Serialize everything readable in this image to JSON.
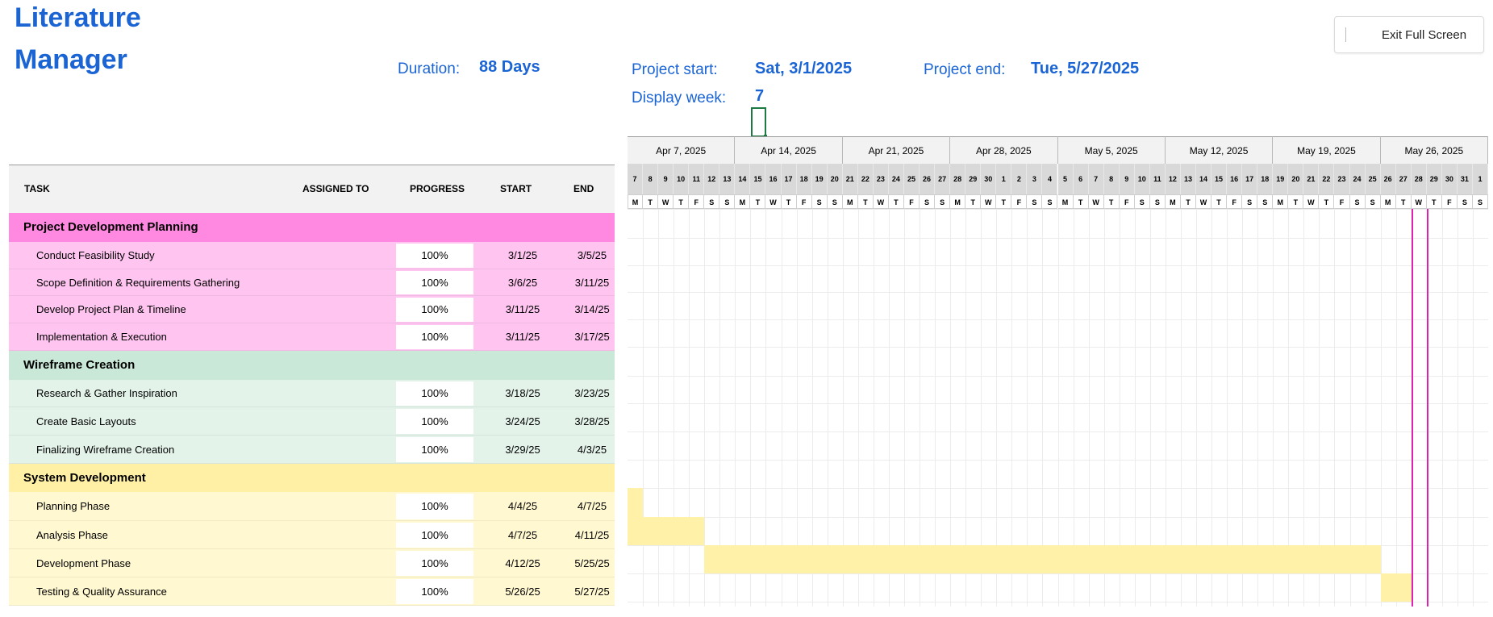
{
  "app": {
    "title_line1": "Literature",
    "title_line2": "Manager",
    "exit_label": "Exit Full Screen"
  },
  "summary": {
    "duration_label": "Duration:",
    "duration_value": "88 Days",
    "start_label": "Project start:",
    "start_value": "Sat, 3/1/2025",
    "end_label": "Project end:",
    "end_value": "Tue, 5/27/2025",
    "week_label": "Display week:",
    "week_value": "7"
  },
  "table": {
    "headers": {
      "task": "TASK",
      "assigned": "ASSIGNED TO",
      "progress": "PROGRESS",
      "start": "START",
      "end": "END"
    },
    "groups": [
      {
        "name": "Project Development Planning",
        "header_color": "#ff88e0",
        "row_color": "#ffc5f0",
        "tasks": [
          {
            "name": "Conduct Feasibility Study",
            "progress": "100%",
            "start": "3/1/25",
            "end": "3/5/25"
          },
          {
            "name": "Scope Definition & Requirements Gathering",
            "progress": "100%",
            "start": "3/6/25",
            "end": "3/11/25"
          },
          {
            "name": "Develop Project Plan & Timeline",
            "progress": "100%",
            "start": "3/11/25",
            "end": "3/14/25"
          },
          {
            "name": "Implementation & Execution",
            "progress": "100%",
            "start": "3/11/25",
            "end": "3/17/25"
          }
        ]
      },
      {
        "name": "Wireframe Creation",
        "header_color": "#c9e8d8",
        "row_color": "#e3f3ea",
        "tasks": [
          {
            "name": "Research & Gather Inspiration",
            "progress": "100%",
            "start": "3/18/25",
            "end": "3/23/25"
          },
          {
            "name": "Create Basic Layouts",
            "progress": "100%",
            "start": "3/24/25",
            "end": "3/28/25"
          },
          {
            "name": "Finalizing Wireframe Creation",
            "progress": "100%",
            "start": "3/29/25",
            "end": "4/3/25"
          }
        ]
      },
      {
        "name": "System Development",
        "header_color": "#fff0a5",
        "row_color": "#fff8d1",
        "tasks": [
          {
            "name": "Planning Phase",
            "progress": "100%",
            "start": "4/4/25",
            "end": "4/7/25"
          },
          {
            "name": "Analysis Phase",
            "progress": "100%",
            "start": "4/7/25",
            "end": "4/11/25"
          },
          {
            "name": "Development Phase",
            "progress": "100%",
            "start": "4/12/25",
            "end": "5/25/25"
          },
          {
            "name": "Testing & Quality Assurance",
            "progress": "100%",
            "start": "5/26/25",
            "end": "5/27/25"
          }
        ]
      }
    ]
  },
  "gantt": {
    "weeks": [
      "Apr 7, 2025",
      "Apr 14, 2025",
      "Apr 21, 2025",
      "Apr 28, 2025",
      "May 5, 2025",
      "May 12, 2025",
      "May 19, 2025",
      "May 26, 2025"
    ],
    "day_numbers": [
      "7",
      "8",
      "9",
      "10",
      "11",
      "12",
      "13",
      "14",
      "15",
      "16",
      "17",
      "18",
      "19",
      "20",
      "21",
      "22",
      "23",
      "24",
      "25",
      "26",
      "27",
      "28",
      "29",
      "30",
      "1",
      "2",
      "3",
      "4",
      "5",
      "6",
      "7",
      "8",
      "9",
      "10",
      "11",
      "12",
      "13",
      "14",
      "15",
      "16",
      "17",
      "18",
      "19",
      "20",
      "21",
      "22",
      "23",
      "24",
      "25",
      "26",
      "27",
      "28",
      "29",
      "30",
      "31",
      "1"
    ],
    "day_letters": [
      "M",
      "T",
      "W",
      "T",
      "F",
      "S",
      "S",
      "M",
      "T",
      "W",
      "T",
      "F",
      "S",
      "S",
      "M",
      "T",
      "W",
      "T",
      "F",
      "S",
      "S",
      "M",
      "T",
      "W",
      "T",
      "F",
      "S",
      "S",
      "M",
      "T",
      "W",
      "T",
      "F",
      "S",
      "S",
      "M",
      "T",
      "W",
      "T",
      "F",
      "S",
      "S",
      "M",
      "T",
      "W",
      "T",
      "F",
      "S",
      "S",
      "M",
      "T",
      "W",
      "T",
      "F",
      "S",
      "S"
    ],
    "today_day_index": 51,
    "bar_color": "#fff2a8",
    "today_color": "#e020b0"
  }
}
